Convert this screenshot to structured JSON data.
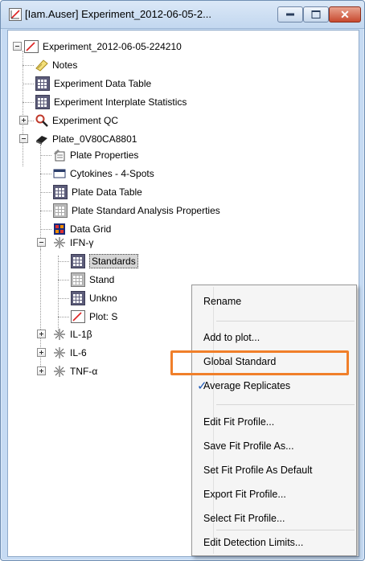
{
  "window": {
    "title": "[Iam.Auser] Experiment_2012-06-05-2...",
    "buttons": {
      "minimize": "minimize",
      "maximize": "maximize",
      "close": "✕"
    }
  },
  "tree": {
    "root": "Experiment_2012-06-05-224210",
    "notes": "Notes",
    "exp_data_table": "Experiment Data Table",
    "exp_interplate": "Experiment Interplate Statistics",
    "exp_qc": "Experiment QC",
    "plate": "Plate_0V80CA8801",
    "plate_props": "Plate Properties",
    "cytokines": "Cytokines - 4-Spots",
    "plate_data_table": "Plate Data Table",
    "plate_std_analysis": "Plate Standard Analysis Properties",
    "data_grid": "Data Grid",
    "ifn": "IFN-γ",
    "standards": "Standards",
    "stand2": "Stand",
    "unkno": "Unkno",
    "plot": "Plot: S",
    "il1b": "IL-1β",
    "il6": "IL-6",
    "tnfa": "TNF-α"
  },
  "context_menu": {
    "items": [
      "Rename",
      "Add to plot...",
      "Global Standard",
      "Average Replicates",
      "Edit Fit Profile...",
      "Save Fit Profile As...",
      "Set Fit Profile As Default",
      "Export Fit Profile...",
      "Select Fit Profile...",
      "Edit Detection Limits..."
    ],
    "checked_item": "Average Replicates",
    "highlighted_item": "Global Standard",
    "highlight_color": "#f07f2a"
  }
}
